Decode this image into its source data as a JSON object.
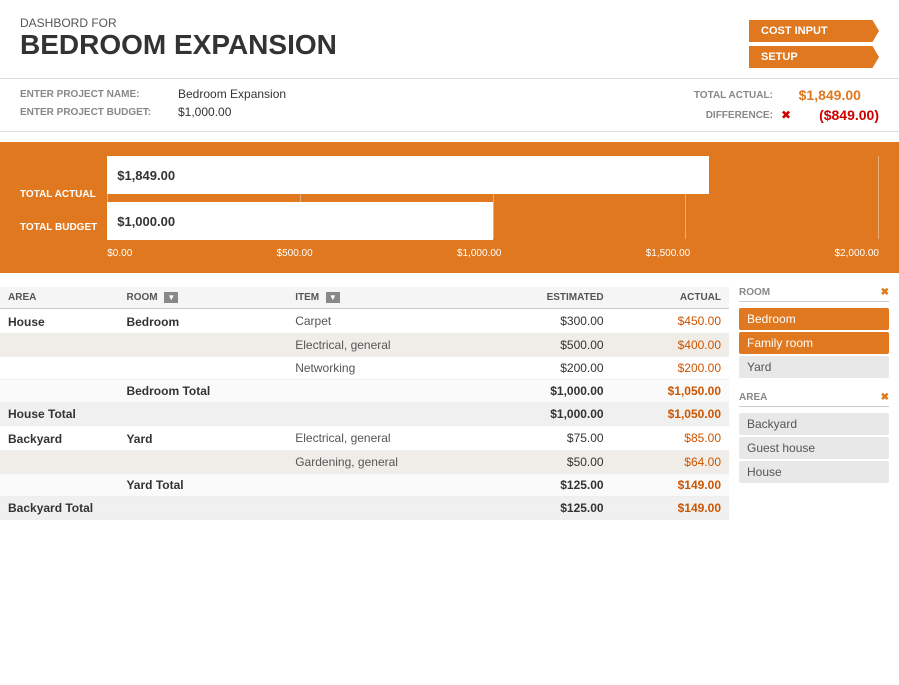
{
  "header": {
    "subtitle": "DASHBORD FOR",
    "title": "BEDROOM EXPANSION",
    "nav_buttons": [
      {
        "label": "COST INPUT",
        "id": "cost-input-btn"
      },
      {
        "label": "SETUP",
        "id": "setup-btn"
      }
    ]
  },
  "project": {
    "name_label": "ENTER PROJECT NAME:",
    "name_value": "Bedroom Expansion",
    "budget_label": "ENTER PROJECT BUDGET:",
    "budget_value": "$1,000.00",
    "total_actual_label": "TOTAL ACTUAL:",
    "total_actual_value": "$1,849.00",
    "difference_label": "DIFFERENCE:",
    "difference_value": "($849.00)"
  },
  "chart": {
    "label_actual": "TOTAL ACTUAL",
    "label_budget": "TOTAL BUDGET",
    "bar_actual_text": "$1,849.00",
    "bar_budget_text": "$1,000.00",
    "axis_labels": [
      "$0.00",
      "$500.00",
      "$1,000.00",
      "$1,500.00",
      "$2,000.00"
    ]
  },
  "table": {
    "columns": [
      "AREA",
      "ROOM",
      "ITEM",
      "ESTIMATED",
      "ACTUAL"
    ],
    "rows": [
      {
        "area": "House",
        "room": "Bedroom",
        "item": "Carpet",
        "estimated": "$300.00",
        "actual": "$450.00",
        "alt": false
      },
      {
        "area": "",
        "room": "",
        "item": "Electrical, general",
        "estimated": "$500.00",
        "actual": "$400.00",
        "alt": true
      },
      {
        "area": "",
        "room": "",
        "item": "Networking",
        "estimated": "$200.00",
        "actual": "$200.00",
        "alt": false
      },
      {
        "area": "",
        "room": "Bedroom Total",
        "item": "",
        "estimated": "$1,000.00",
        "actual": "$1,050.00",
        "subtotal": true
      },
      {
        "area": "House Total",
        "room": "",
        "item": "",
        "estimated": "$1,000.00",
        "actual": "$1,050.00",
        "area_total": true
      },
      {
        "area": "Backyard",
        "room": "Yard",
        "item": "Electrical, general",
        "estimated": "$75.00",
        "actual": "$85.00",
        "alt": false
      },
      {
        "area": "",
        "room": "",
        "item": "Gardening, general",
        "estimated": "$50.00",
        "actual": "$64.00",
        "alt": true
      },
      {
        "area": "",
        "room": "Yard Total",
        "item": "",
        "estimated": "$125.00",
        "actual": "$149.00",
        "subtotal": true
      },
      {
        "area": "Backyard Total",
        "room": "",
        "item": "",
        "estimated": "$125.00",
        "actual": "$149.00",
        "area_total": true
      }
    ]
  },
  "filter_panel": {
    "room_section": {
      "title": "ROOM",
      "items": [
        {
          "label": "Bedroom",
          "active": true
        },
        {
          "label": "Family room",
          "active": true
        },
        {
          "label": "Yard",
          "active": false
        }
      ]
    },
    "area_section": {
      "title": "AREA",
      "items": [
        {
          "label": "Backyard",
          "active": false
        },
        {
          "label": "Guest house",
          "active": false
        },
        {
          "label": "House",
          "active": false
        }
      ]
    }
  }
}
